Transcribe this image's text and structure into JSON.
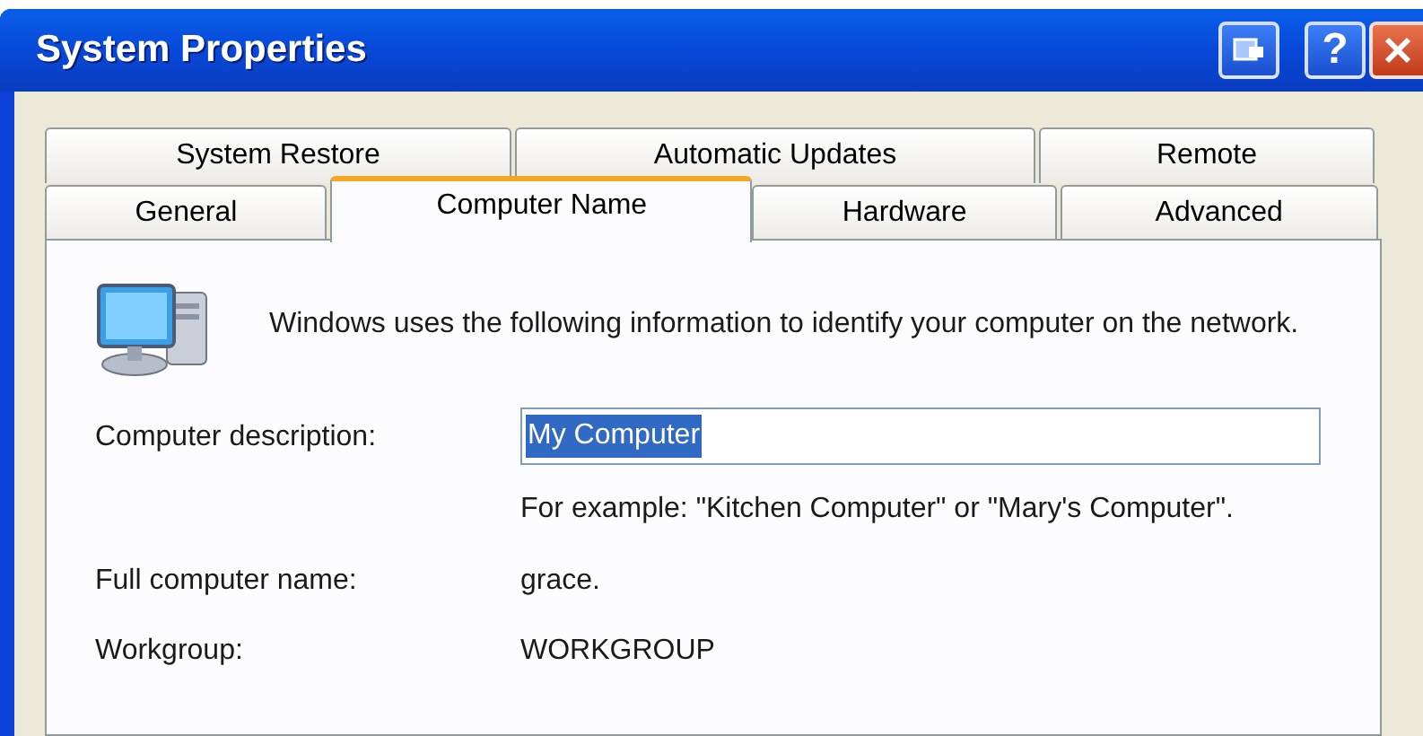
{
  "window": {
    "title": "System Properties",
    "help_button": "?"
  },
  "tab_rows": [
    [
      {
        "label": "System Restore",
        "selected": false
      },
      {
        "label": "Automatic Updates",
        "selected": false
      },
      {
        "label": "Remote",
        "selected": false
      }
    ],
    [
      {
        "label": "General",
        "selected": false
      },
      {
        "label": "Computer Name",
        "selected": true
      },
      {
        "label": "Hardware",
        "selected": false
      },
      {
        "label": "Advanced",
        "selected": false
      }
    ]
  ],
  "intro": "Windows uses the following information to identify your computer on the network.",
  "fields": [
    {
      "kind": "input",
      "label": "Computer description:",
      "value": "My Computer",
      "text_selected": true,
      "hint": "For example: \"Kitchen Computer\" or \"Mary's Computer\"."
    },
    {
      "kind": "text",
      "label": "Full computer name:",
      "value": "grace."
    },
    {
      "kind": "text",
      "label": "Workgroup:",
      "value": "WORKGROUP"
    }
  ]
}
